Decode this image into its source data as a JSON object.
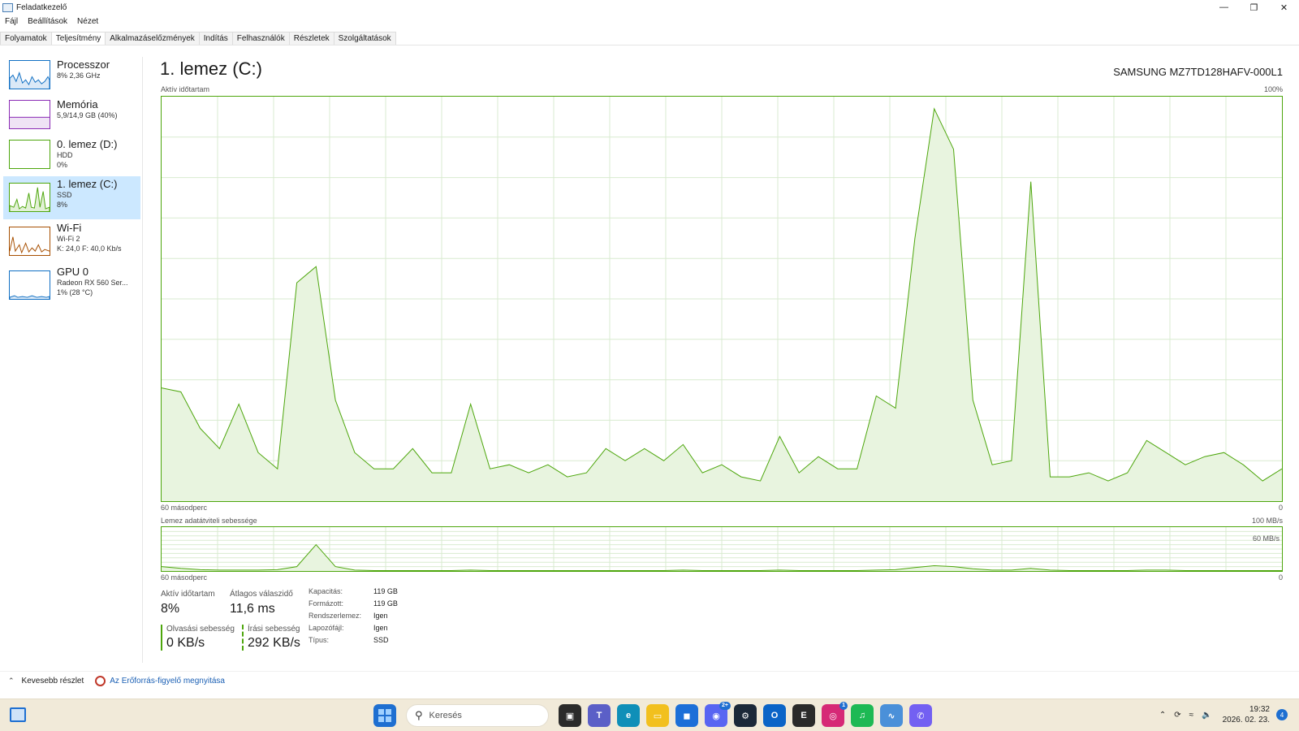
{
  "window": {
    "title": "Feladatkezelő",
    "controls": {
      "minimize": "—",
      "maximize": "❐",
      "close": "✕"
    }
  },
  "menu": [
    "Fájl",
    "Beállítások",
    "Nézet"
  ],
  "tabs": [
    {
      "label": "Folyamatok",
      "active": false
    },
    {
      "label": "Teljesítmény",
      "active": true
    },
    {
      "label": "Alkalmazáselőzmények",
      "active": false
    },
    {
      "label": "Indítás",
      "active": false
    },
    {
      "label": "Felhasználók",
      "active": false
    },
    {
      "label": "Részletek",
      "active": false
    },
    {
      "label": "Szolgáltatások",
      "active": false
    }
  ],
  "sidebar": {
    "items": [
      {
        "name": "Processzor",
        "line1": "8% 2,36 GHz",
        "line2": "",
        "color": "#1170c4",
        "selected": false
      },
      {
        "name": "Memória",
        "line1": "5,9/14,9 GB (40%)",
        "line2": "",
        "color": "#8b2bb5",
        "selected": false
      },
      {
        "name": "0. lemez (D:)",
        "line1": "HDD",
        "line2": "0%",
        "color": "#4da60c",
        "selected": false
      },
      {
        "name": "1. lemez (C:)",
        "line1": "SSD",
        "line2": "8%",
        "color": "#4da60c",
        "selected": true
      },
      {
        "name": "Wi-Fi",
        "line1": "Wi-Fi 2",
        "line2": "K: 24,0 F: 40,0 Kb/s",
        "color": "#a74f01",
        "selected": false
      },
      {
        "name": "GPU 0",
        "line1": "Radeon RX 560 Ser...",
        "line2": "1% (28 °C)",
        "color": "#1170c4",
        "selected": false
      }
    ]
  },
  "main": {
    "title": "1. lemez (C:)",
    "device": "SAMSUNG MZ7TD128HAFV-000L1",
    "active_time_label": "Aktív időtartam",
    "active_time_max": "100%",
    "time_left": "60 másodperc",
    "time_right": "0",
    "transfer_label": "Lemez adatátviteli sebessége",
    "transfer_max": "100 MB/s",
    "transfer_mark": "60 MB/s"
  },
  "chart_data": {
    "type": "area",
    "series": [
      {
        "values": [
          28,
          27,
          18,
          13,
          24,
          12,
          8,
          54,
          58,
          25,
          12,
          8,
          8,
          13,
          7,
          7,
          24,
          8,
          9,
          7,
          9,
          6,
          7,
          13,
          10,
          13,
          10,
          14,
          7,
          9,
          6,
          5,
          16,
          7,
          11,
          8,
          8,
          26,
          23,
          65,
          97,
          87,
          25,
          9,
          10,
          79,
          6,
          6,
          7,
          5,
          7,
          15,
          12,
          9,
          11,
          12,
          9,
          5,
          8
        ]
      },
      {
        "values": [
          10,
          6,
          3,
          2,
          2,
          2,
          3,
          10,
          60,
          10,
          2,
          1,
          1,
          1,
          1,
          1,
          2,
          1,
          1,
          1,
          1,
          1,
          1,
          1,
          1,
          1,
          1,
          2,
          1,
          1,
          1,
          1,
          2,
          1,
          1,
          1,
          1,
          2,
          3,
          8,
          12,
          10,
          5,
          2,
          2,
          6,
          2,
          1,
          1,
          1,
          1,
          2,
          2,
          1,
          1,
          1,
          1,
          1,
          1
        ]
      }
    ],
    "ylim": [
      0,
      100
    ],
    "grid": true
  },
  "stats": {
    "active_time": {
      "label": "Aktív időtartam",
      "value": "8%"
    },
    "avg_response": {
      "label": "Átlagos válaszidő",
      "value": "11,6 ms"
    },
    "read_speed": {
      "label": "Olvasási sebesség",
      "value": "0 KB/s"
    },
    "write_speed": {
      "label": "Írási sebesség",
      "value": "292 KB/s"
    }
  },
  "properties": [
    {
      "key": "Kapacitás:",
      "value": "119 GB"
    },
    {
      "key": "Formázott:",
      "value": "119 GB"
    },
    {
      "key": "Rendszerlemez:",
      "value": "Igen"
    },
    {
      "key": "Lapozófájl:",
      "value": "Igen"
    },
    {
      "key": "Típus:",
      "value": "SSD"
    }
  ],
  "footer": {
    "less_details": "Kevesebb részlet",
    "resmon": "Az Erőforrás-figyelő megnyitása"
  },
  "taskbar": {
    "search_placeholder": "Keresés",
    "icons": [
      {
        "name": "start",
        "color": "#1e6fd1",
        "badge": ""
      },
      {
        "name": "task-view",
        "color": "#2b2b2b",
        "badge": ""
      },
      {
        "name": "teams",
        "color": "#5b5fc7",
        "badge": ""
      },
      {
        "name": "edge",
        "color": "#0f8fb8",
        "badge": ""
      },
      {
        "name": "file-explorer",
        "color": "#f2c01e",
        "badge": ""
      },
      {
        "name": "store",
        "color": "#1c6fd8",
        "badge": ""
      },
      {
        "name": "discord",
        "color": "#5865f2",
        "badge": "2+"
      },
      {
        "name": "steam",
        "color": "#1b2838",
        "badge": ""
      },
      {
        "name": "outlook",
        "color": "#0a64c7",
        "badge": ""
      },
      {
        "name": "epic-games",
        "color": "#2a2a2a",
        "badge": ""
      },
      {
        "name": "instagram",
        "color": "#d62976",
        "badge": "1"
      },
      {
        "name": "spotify",
        "color": "#1db954",
        "badge": ""
      },
      {
        "name": "task-manager",
        "color": "#4a90d9",
        "badge": ""
      },
      {
        "name": "viber",
        "color": "#7360f2",
        "badge": ""
      }
    ],
    "time": "19:32",
    "date": "2026. 02. 23.",
    "notification_count": "4"
  }
}
